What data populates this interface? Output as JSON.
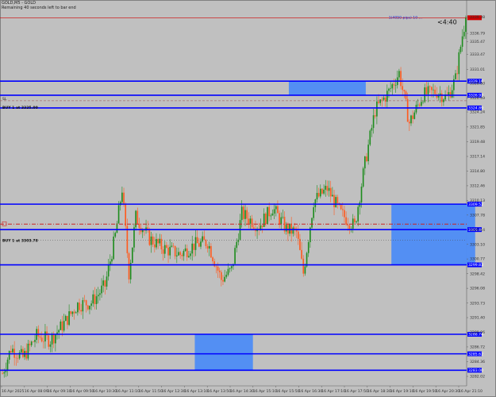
{
  "header": {
    "symbol_line": "GOLD,M5 - GOLD",
    "timer_line": "Remaining 40 seconds left to bar end"
  },
  "timer": "<4:40",
  "spread_label": "1(4050 pips) 10 ...",
  "colors": {
    "background": "#c0c0c0",
    "bull": "#1e8c1e",
    "bear": "#ff5a1e",
    "level": "#0000ff",
    "zone": "#4d8cf5",
    "red_line": "#cc2222",
    "current_price": "#d00000"
  },
  "chart_data": {
    "type": "candlestick",
    "ylim": [
      3280.5,
      3340.6
    ],
    "y_ticks": [
      "3339.38",
      "3336.79",
      "3335.47",
      "3333.47",
      "3331.01",
      "3328.80",
      "3326.49",
      "3324.24",
      "3321.85",
      "3319.48",
      "3317.14",
      "3314.80",
      "3312.46",
      "3310.13",
      "3307.78",
      "3305.44",
      "3303.10",
      "3300.77",
      "3298.42",
      "3296.08",
      "3293.73",
      "3291.40",
      "3289.06",
      "3286.72",
      "3284.36",
      "3282.02",
      "3279.68"
    ],
    "x_ticks": [
      "16 Apr 2025",
      "16 Apr 08:09",
      "16 Apr 09:10",
      "16 Apr 09:50",
      "16 Apr 10:30",
      "16 Apr 11:10",
      "16 Apr 11:50",
      "16 Apr 12:30",
      "16 Apr 13:10",
      "16 Apr 13:50",
      "16 Apr 14:30",
      "16 Apr 15:10",
      "16 Apr 15:50",
      "16 Apr 16:30",
      "16 Apr 17:10",
      "16 Apr 17:50",
      "16 Apr 18:30",
      "16 Apr 19:10",
      "16 Apr 19:50",
      "16 Apr 20:30",
      "16 Apr 21:10"
    ],
    "current_price": 3339.29,
    "levels": [
      {
        "price": 3329.16,
        "label": "3329.16"
      },
      {
        "price": 3326.92,
        "label": "3326.92"
      },
      {
        "price": 3324.89,
        "label": "3324.89"
      },
      {
        "price": 3309.52,
        "label": "3309.52"
      },
      {
        "price": 3305.46,
        "label": "3305.46"
      },
      {
        "price": 3299.83,
        "label": "3299.83"
      },
      {
        "price": 3288.74,
        "label": "3288.74"
      },
      {
        "price": 3285.62,
        "label": "3285.62"
      },
      {
        "price": 3283.0,
        "label": "3283.00"
      }
    ],
    "zones": [
      {
        "from_bar": 168,
        "to_bar": 213,
        "low": 3326.92,
        "high": 3329.16
      },
      {
        "from_bar": 228,
        "to_bar": 277,
        "low": 3299.83,
        "high": 3309.52
      },
      {
        "from_bar": 113,
        "to_bar": 147,
        "low": 3283.0,
        "high": 3288.74
      }
    ],
    "orders": [
      {
        "label": "BUY 1 at 3325.00",
        "price": 3325.0
      },
      {
        "label": "BUY 1 at 3303.78",
        "price": 3303.78
      }
    ],
    "sl_label": "SL",
    "sl_price": 3326.03,
    "red_dash_price": 3306.33,
    "dotted_price": 3303.78,
    "candle_count": 272,
    "candle_seed": 7,
    "path_keypoints": [
      [
        0,
        3282.5
      ],
      [
        5,
        3286.5
      ],
      [
        12,
        3285.0
      ],
      [
        20,
        3288.5
      ],
      [
        28,
        3287.8
      ],
      [
        36,
        3290.5
      ],
      [
        44,
        3293.5
      ],
      [
        52,
        3293.8
      ],
      [
        60,
        3296.5
      ],
      [
        66,
        3304.5
      ],
      [
        70,
        3312.0
      ],
      [
        74,
        3298.5
      ],
      [
        78,
        3307.5
      ],
      [
        86,
        3304.0
      ],
      [
        94,
        3302.5
      ],
      [
        104,
        3301.5
      ],
      [
        112,
        3303.0
      ],
      [
        120,
        3303.5
      ],
      [
        128,
        3297.5
      ],
      [
        134,
        3299.0
      ],
      [
        140,
        3308.0
      ],
      [
        150,
        3306.0
      ],
      [
        158,
        3309.0
      ],
      [
        166,
        3305.5
      ],
      [
        172,
        3305.0
      ],
      [
        176,
        3298.5
      ],
      [
        182,
        3310.0
      ],
      [
        190,
        3312.0
      ],
      [
        198,
        3308.0
      ],
      [
        206,
        3306.0
      ],
      [
        212,
        3316.0
      ],
      [
        218,
        3324.5
      ],
      [
        226,
        3327.5
      ],
      [
        232,
        3330.5
      ],
      [
        238,
        3322.5
      ],
      [
        246,
        3327.0
      ],
      [
        254,
        3327.5
      ],
      [
        260,
        3326.5
      ],
      [
        265,
        3329.5
      ],
      [
        269,
        3336.5
      ],
      [
        271,
        3339.3
      ]
    ]
  }
}
